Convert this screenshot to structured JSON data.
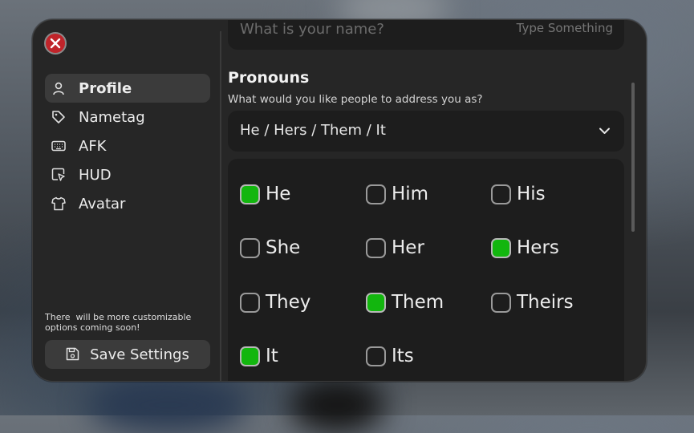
{
  "close": {
    "icon": "close-icon"
  },
  "sidebar": {
    "items": [
      {
        "label": "Profile",
        "icon": "user-icon",
        "active": true
      },
      {
        "label": "Nametag",
        "icon": "tag-icon",
        "active": false
      },
      {
        "label": "AFK",
        "icon": "keyboard-icon",
        "active": false
      },
      {
        "label": "HUD",
        "icon": "cursor-window-icon",
        "active": false
      },
      {
        "label": "Avatar",
        "icon": "shirt-icon",
        "active": false
      }
    ],
    "notice": "There  will be more customizable\noptions coming soon!",
    "save_label": "Save Settings",
    "save_icon": "save-icon"
  },
  "profile": {
    "name_label": "What is your name?",
    "name_placeholder": "Type Something"
  },
  "pronouns": {
    "title": "Pronouns",
    "subtitle": "What would you like people to address you as?",
    "selected": "He / Hers / Them / It",
    "options": [
      {
        "label": "He",
        "checked": true
      },
      {
        "label": "Him",
        "checked": false
      },
      {
        "label": "His",
        "checked": false
      },
      {
        "label": "She",
        "checked": false
      },
      {
        "label": "Her",
        "checked": false
      },
      {
        "label": "Hers",
        "checked": true
      },
      {
        "label": "They",
        "checked": false
      },
      {
        "label": "Them",
        "checked": true
      },
      {
        "label": "Theirs",
        "checked": false
      },
      {
        "label": "It",
        "checked": true
      },
      {
        "label": "Its",
        "checked": false
      }
    ]
  },
  "colors": {
    "accent_check": "#12b60e",
    "close_red": "#c0242a",
    "panel_bg": "#262626",
    "field_bg": "#1d1d1d"
  }
}
